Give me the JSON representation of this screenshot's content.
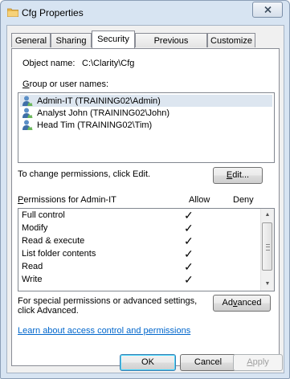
{
  "window": {
    "title": "Cfg Properties",
    "close_label": "⨯"
  },
  "tabs": [
    {
      "label": "General"
    },
    {
      "label": "Sharing"
    },
    {
      "label": "Security"
    },
    {
      "label": "Previous Versions"
    },
    {
      "label": "Customize"
    }
  ],
  "security": {
    "object_name_label": "Object name:",
    "object_name_value": "C:\\Clarity\\Cfg",
    "group_label": "Group or user names:",
    "users": [
      {
        "label": "Admin-IT (TRAINING02\\Admin)",
        "selected": true,
        "icon": "user-icon"
      },
      {
        "label": "Analyst John (TRAINING02\\John)",
        "selected": false,
        "icon": "user-icon"
      },
      {
        "label": "Head Tim (TRAINING02\\Tim)",
        "selected": false,
        "icon": "user-icon"
      }
    ],
    "change_hint": "To change permissions, click Edit.",
    "edit_button": "Edit...",
    "permissions_for_label": "Permissions for Admin-IT",
    "allow_header": "Allow",
    "deny_header": "Deny",
    "permissions": [
      {
        "name": "Full control",
        "allow": "✓",
        "deny": ""
      },
      {
        "name": "Modify",
        "allow": "✓",
        "deny": ""
      },
      {
        "name": "Read & execute",
        "allow": "✓",
        "deny": ""
      },
      {
        "name": "List folder contents",
        "allow": "✓",
        "deny": ""
      },
      {
        "name": "Read",
        "allow": "✓",
        "deny": ""
      },
      {
        "name": "Write",
        "allow": "✓",
        "deny": ""
      }
    ],
    "special_hint_line1": "For special permissions or advanced settings,",
    "special_hint_line2": "click Advanced.",
    "advanced_button": "Advanced",
    "learn_link": "Learn about access control and permissions"
  },
  "footer": {
    "ok_button": "OK",
    "cancel_button": "Cancel",
    "apply_button": "Apply"
  },
  "colors": {
    "window_frame": "#d7e4f2",
    "selection": "#dde6f0",
    "link": "#0066cc"
  }
}
